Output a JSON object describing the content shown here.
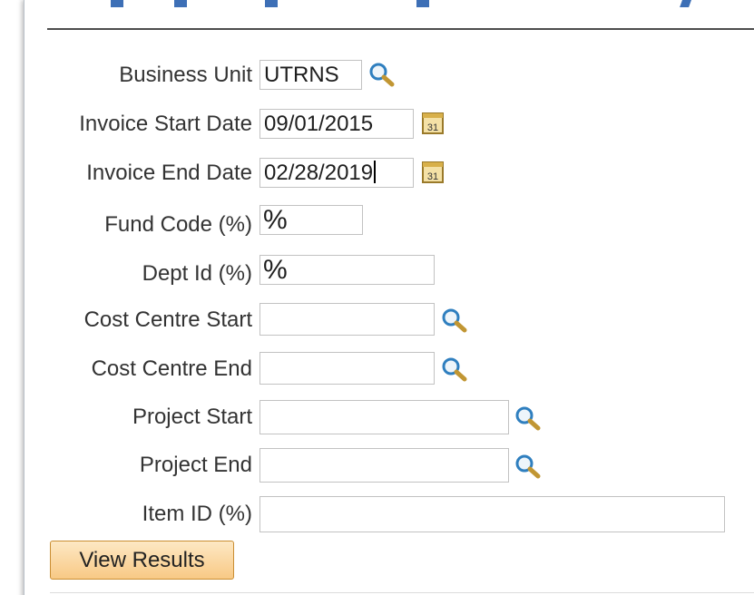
{
  "form": {
    "business_unit": {
      "label": "Business Unit",
      "value": "UTRNS"
    },
    "invoice_start_date": {
      "label": "Invoice Start Date",
      "value": "09/01/2015",
      "calendar_glyph": "31"
    },
    "invoice_end_date": {
      "label": "Invoice End Date",
      "value": "02/28/2019",
      "calendar_glyph": "31"
    },
    "fund_code": {
      "label": "Fund Code (%)",
      "value": "%"
    },
    "dept_id": {
      "label": "Dept Id (%)",
      "value": "%"
    },
    "cost_centre_start": {
      "label": "Cost Centre Start",
      "value": ""
    },
    "cost_centre_end": {
      "label": "Cost Centre End",
      "value": ""
    },
    "project_start": {
      "label": "Project Start",
      "value": ""
    },
    "project_end": {
      "label": "Project End",
      "value": ""
    },
    "item_id": {
      "label": "Item ID (%)",
      "value": ""
    }
  },
  "actions": {
    "view_results_label": "View Results"
  },
  "icons": {
    "lookup": "magnifier-lookup-icon",
    "calendar": "calendar-icon"
  },
  "colors": {
    "button_top": "#fde8c4",
    "button_bottom": "#f8c985",
    "button_border": "#c98d32",
    "tab_accent": "#3d6fb6",
    "label_text": "#333333"
  }
}
